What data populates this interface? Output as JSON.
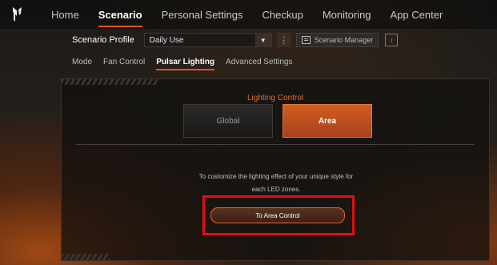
{
  "topnav": {
    "items": [
      {
        "label": "Home"
      },
      {
        "label": "Scenario"
      },
      {
        "label": "Personal Settings"
      },
      {
        "label": "Checkup"
      },
      {
        "label": "Monitoring"
      },
      {
        "label": "App Center"
      }
    ],
    "active_index": 1
  },
  "profile": {
    "label": "Scenario Profile",
    "selected": "Daily Use",
    "manager_label": "Scenario Manager"
  },
  "subtabs": {
    "items": [
      {
        "label": "Mode"
      },
      {
        "label": "Fan Control"
      },
      {
        "label": "Pulsar Lighting"
      },
      {
        "label": "Advanced Settings"
      }
    ],
    "active_index": 2
  },
  "lighting": {
    "title": "Lighting Control",
    "global_label": "Global",
    "area_label": "Area",
    "selected": "Area",
    "description_line1": "To customize the lighting effect of your unique style for",
    "description_line2": "each LED zones.",
    "area_button_label": "To Area Control"
  },
  "colors": {
    "accent": "#e0561a",
    "highlight_box": "#e01010"
  }
}
